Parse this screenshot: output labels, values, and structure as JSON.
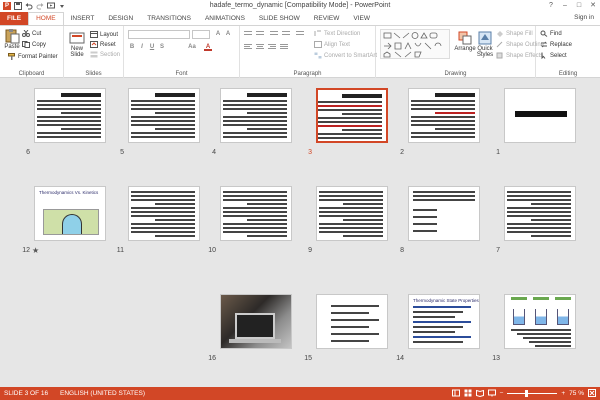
{
  "window": {
    "title": "hadafe_termo_dynamic [Compatibility Mode] - PowerPoint",
    "app_badge": "P",
    "controls": [
      "?",
      "–",
      "□",
      "✕"
    ]
  },
  "tabs": [
    "FILE",
    "HOME",
    "INSERT",
    "DESIGN",
    "TRANSITIONS",
    "ANIMATIONS",
    "SLIDE SHOW",
    "REVIEW",
    "VIEW"
  ],
  "active_tab": "HOME",
  "signin": "Sign in",
  "ribbon": {
    "clipboard": {
      "label": "Clipboard",
      "paste": "Paste",
      "cut": "Cut",
      "copy": "Copy",
      "format_painter": "Format Painter"
    },
    "slides": {
      "label": "Slides",
      "new_slide": "New Slide",
      "layout": "Layout",
      "reset": "Reset",
      "section": "Section"
    },
    "font": {
      "label": "Font",
      "bold": "B",
      "italic": "I",
      "underline": "U",
      "strike": "S",
      "case": "Aa"
    },
    "paragraph": {
      "label": "Paragraph",
      "text_direction": "Text Direction",
      "align_text": "Align Text",
      "smartart": "Convert to SmartArt"
    },
    "drawing": {
      "label": "Drawing",
      "arrange": "Arrange",
      "quick_styles": "Quick Styles",
      "shape_fill": "Shape Fill",
      "shape_outline": "Shape Outline",
      "shape_effects": "Shape Effects"
    },
    "editing": {
      "label": "Editing",
      "find": "Find",
      "replace": "Replace",
      "select": "Select"
    }
  },
  "slides": [
    {
      "num": "1",
      "type": "title",
      "title": "ترمودینامیک"
    },
    {
      "num": "2",
      "type": "text",
      "title": "هدف ترمودینامیک"
    },
    {
      "num": "3",
      "type": "text",
      "title": "سیستم ترمودینامیکی",
      "selected": true
    },
    {
      "num": "4",
      "type": "text",
      "title": "تعادل سیستم"
    },
    {
      "num": "5",
      "type": "text",
      "title": "قرارداد علامت"
    },
    {
      "num": "6",
      "type": "text",
      "title": "کار"
    },
    {
      "num": "7",
      "type": "text",
      "title": ""
    },
    {
      "num": "8",
      "type": "equations",
      "title": ""
    },
    {
      "num": "9",
      "type": "text",
      "title": ""
    },
    {
      "num": "10",
      "type": "text",
      "title": ""
    },
    {
      "num": "11",
      "type": "text",
      "title": ""
    },
    {
      "num": "12",
      "type": "chart",
      "title": "Thermodynamics Vs. Kinetics",
      "transition": true
    },
    {
      "num": "13",
      "type": "beakers",
      "title": ""
    },
    {
      "num": "14",
      "type": "english",
      "title": "Thermodynamic State Properties"
    },
    {
      "num": "15",
      "type": "bullets",
      "title": ""
    },
    {
      "num": "16",
      "type": "photo",
      "title": ""
    }
  ],
  "transition_marker": "★",
  "status": {
    "slide": "SLIDE 3 OF 16",
    "language": "ENGLISH (UNITED STATES)",
    "zoom": "75 %",
    "zoom_minus": "−",
    "zoom_plus": "+"
  }
}
